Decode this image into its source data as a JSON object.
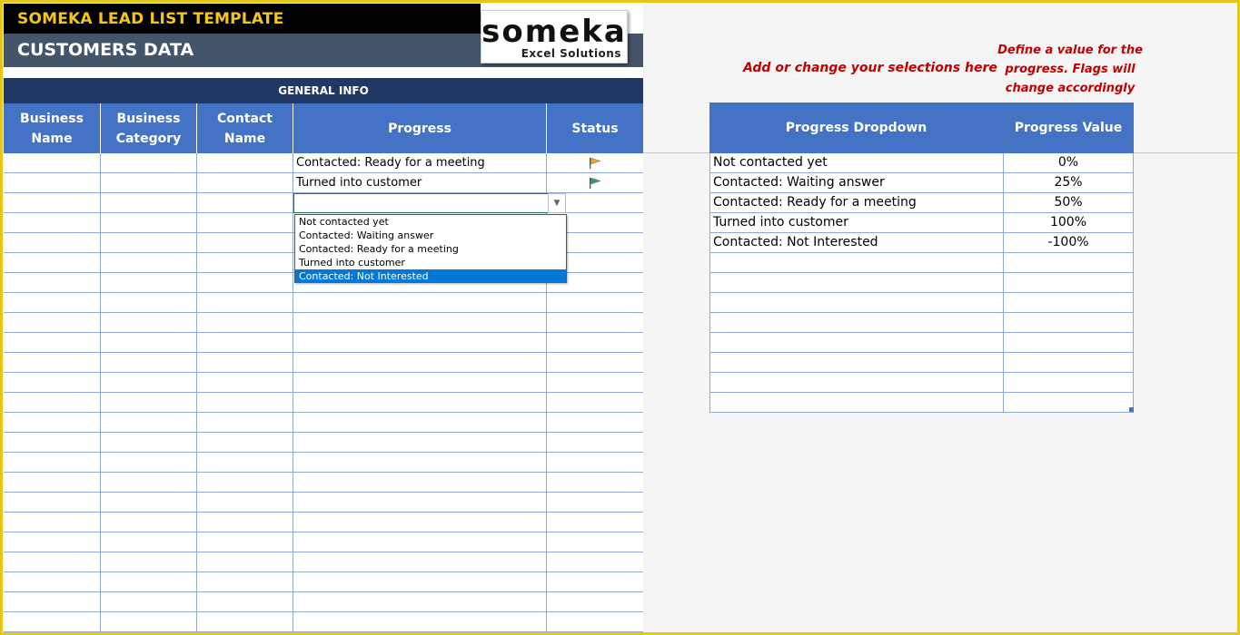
{
  "header": {
    "title": "SOMEKA LEAD LIST TEMPLATE",
    "subtitle": "CUSTOMERS DATA",
    "logo_word": "someka",
    "logo_sub": "Excel Solutions"
  },
  "left_table": {
    "group_label": "GENERAL INFO",
    "columns": [
      {
        "label": "Business Name"
      },
      {
        "label": "Business Category"
      },
      {
        "label": "Contact Name"
      },
      {
        "label": "Progress"
      },
      {
        "label": "Status"
      }
    ],
    "rows": [
      {
        "progress": "Contacted: Ready for a meeting",
        "flag": "orange-flag-icon",
        "flag_color": "#e8a33d"
      },
      {
        "progress": "Turned into customer",
        "flag": "green-flag-icon",
        "flag_color": "#3a9a6c"
      }
    ]
  },
  "dropdown": {
    "options": [
      "Not contacted yet",
      "Contacted: Waiting answer",
      "Contacted: Ready for a meeting",
      "Turned into customer",
      "Contacted: Not Interested"
    ],
    "highlighted": "Contacted: Not Interested"
  },
  "notes": {
    "selections": "Add or change your selections here",
    "define": "Define a value for the progress. Flags will change accordingly"
  },
  "right_table": {
    "headers": [
      "Progress Dropdown",
      "Progress Value"
    ],
    "rows": [
      {
        "label": "Not contacted yet",
        "value": "0%"
      },
      {
        "label": "Contacted: Waiting answer",
        "value": "25%"
      },
      {
        "label": "Contacted: Ready for a meeting",
        "value": "50%"
      },
      {
        "label": "Turned into customer",
        "value": "100%"
      },
      {
        "label": "Contacted: Not Interested",
        "value": "-100%"
      }
    ]
  },
  "colors": {
    "frame": "#e6c619",
    "title_text": "#f5c518",
    "header_blue": "#4472c4",
    "group_navy": "#1f3864",
    "note_red": "#c00000"
  }
}
